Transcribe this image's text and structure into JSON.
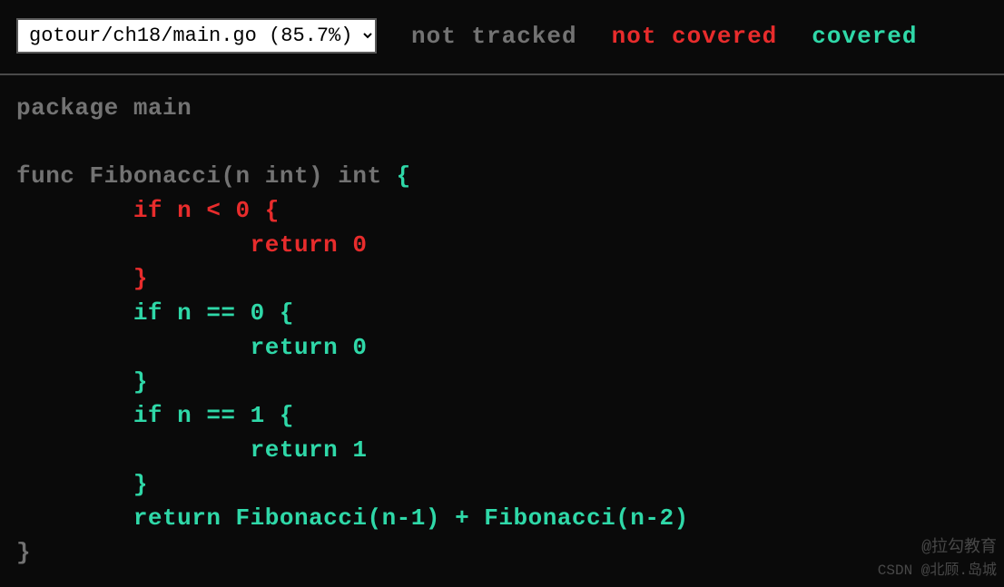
{
  "header": {
    "file_selector": "gotour/ch18/main.go (85.7%)",
    "legend": {
      "not_tracked": "not tracked",
      "not_covered": "not covered",
      "covered": "covered"
    }
  },
  "code": {
    "line1": "package main",
    "line2": "",
    "line3_a": "func Fibonacci(n int) int ",
    "line3_b": "{",
    "line4": "        if n < 0 {",
    "line5": "                return 0",
    "line6": "        }",
    "line7": "        if n == 0 {",
    "line8": "                return 0",
    "line9": "        }",
    "line10": "        if n == 1 {",
    "line11": "                return 1",
    "line12": "        }",
    "line13": "        return Fibonacci(n-1) + Fibonacci(n-2)",
    "line14": "}"
  },
  "watermark1": "@拉勾教育",
  "watermark2": "CSDN @北顾.岛城"
}
